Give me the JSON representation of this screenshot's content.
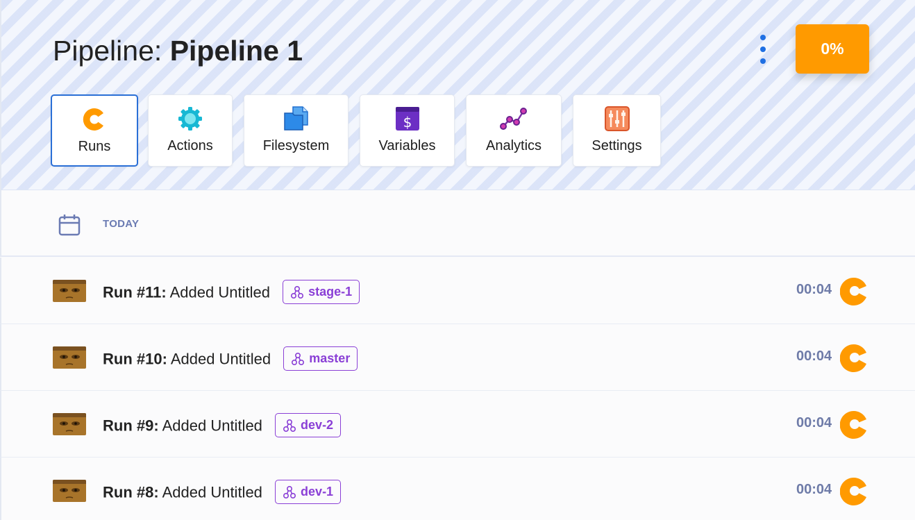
{
  "header": {
    "title_prefix": "Pipeline:",
    "title_name": "Pipeline 1",
    "progress_label": "0%",
    "more_menu_icon": "kebab-vertical-icon"
  },
  "tabs": [
    {
      "label": "Runs",
      "icon": "runs-pacman-icon",
      "active": true
    },
    {
      "label": "Actions",
      "icon": "gear-icon",
      "active": false
    },
    {
      "label": "Filesystem",
      "icon": "folder-icon",
      "active": false
    },
    {
      "label": "Variables",
      "icon": "dollar-icon",
      "active": false
    },
    {
      "label": "Analytics",
      "icon": "analytics-icon",
      "active": false
    },
    {
      "label": "Settings",
      "icon": "sliders-icon",
      "active": false
    }
  ],
  "date_group": {
    "label": "TODAY",
    "icon": "calendar-icon"
  },
  "runs": [
    {
      "number": "Run #11:",
      "message": "Added Untitled",
      "branch": "stage-1",
      "duration": "00:04"
    },
    {
      "number": "Run #10:",
      "message": "Added Untitled",
      "branch": "master",
      "duration": "00:04"
    },
    {
      "number": "Run #9:",
      "message": "Added Untitled",
      "branch": "dev-2",
      "duration": "00:04"
    },
    {
      "number": "Run #8:",
      "message": "Added Untitled",
      "branch": "dev-1",
      "duration": "00:04"
    }
  ],
  "colors": {
    "accent": "#ff9a00",
    "branch": "#8a3fd6",
    "active_tab": "#2a6fd6",
    "muted": "#6e7ba8"
  }
}
